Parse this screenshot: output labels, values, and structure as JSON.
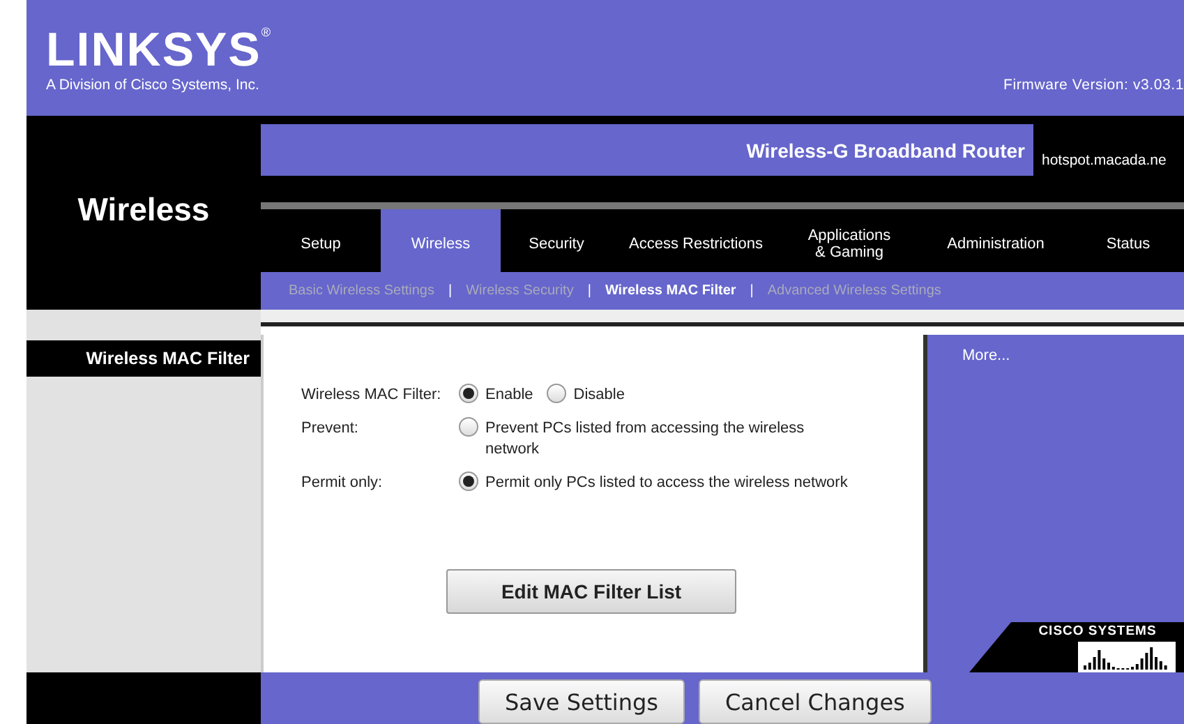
{
  "brand": {
    "logo": "LINKSYS",
    "registered": "®",
    "tagline": "A Division of Cisco Systems, Inc.",
    "firmware": "Firmware Version: v3.03.1"
  },
  "product": {
    "name": "Wireless-G Broadband Router",
    "hostname": "hotspot.macada.ne"
  },
  "section": "Wireless",
  "tabs": [
    {
      "label": "Setup",
      "selected": false
    },
    {
      "label": "Wireless",
      "selected": true
    },
    {
      "label": "Security",
      "selected": false
    },
    {
      "label": "Access Restrictions",
      "selected": false
    },
    {
      "label": "Applications & Gaming",
      "selected": false
    },
    {
      "label": "Administration",
      "selected": false
    },
    {
      "label": "Status",
      "selected": false
    }
  ],
  "subtabs": [
    {
      "label": "Basic Wireless Settings",
      "selected": false
    },
    {
      "label": "Wireless Security",
      "selected": false
    },
    {
      "label": "Wireless MAC Filter",
      "selected": true
    },
    {
      "label": "Advanced Wireless Settings",
      "selected": false
    }
  ],
  "subtab_separator": "|",
  "page_title": "Wireless MAC Filter",
  "form": {
    "rows": [
      {
        "label": "Wireless MAC Filter:",
        "options": [
          {
            "label": "Enable",
            "selected": true
          },
          {
            "label": "Disable",
            "selected": false
          }
        ]
      },
      {
        "label": "Prevent:",
        "options": [
          {
            "label": "Prevent PCs listed from accessing the wireless network",
            "selected": false
          }
        ]
      },
      {
        "label": "Permit only:",
        "options": [
          {
            "label": "Permit only PCs listed to access the wireless network",
            "selected": true
          }
        ]
      }
    ],
    "edit_button": "Edit MAC Filter List"
  },
  "help": {
    "link": "More..."
  },
  "vendor_logo": "CISCO SYSTEMS",
  "buttons": [
    {
      "label": "Save Settings"
    },
    {
      "label": "Cancel Changes"
    }
  ]
}
